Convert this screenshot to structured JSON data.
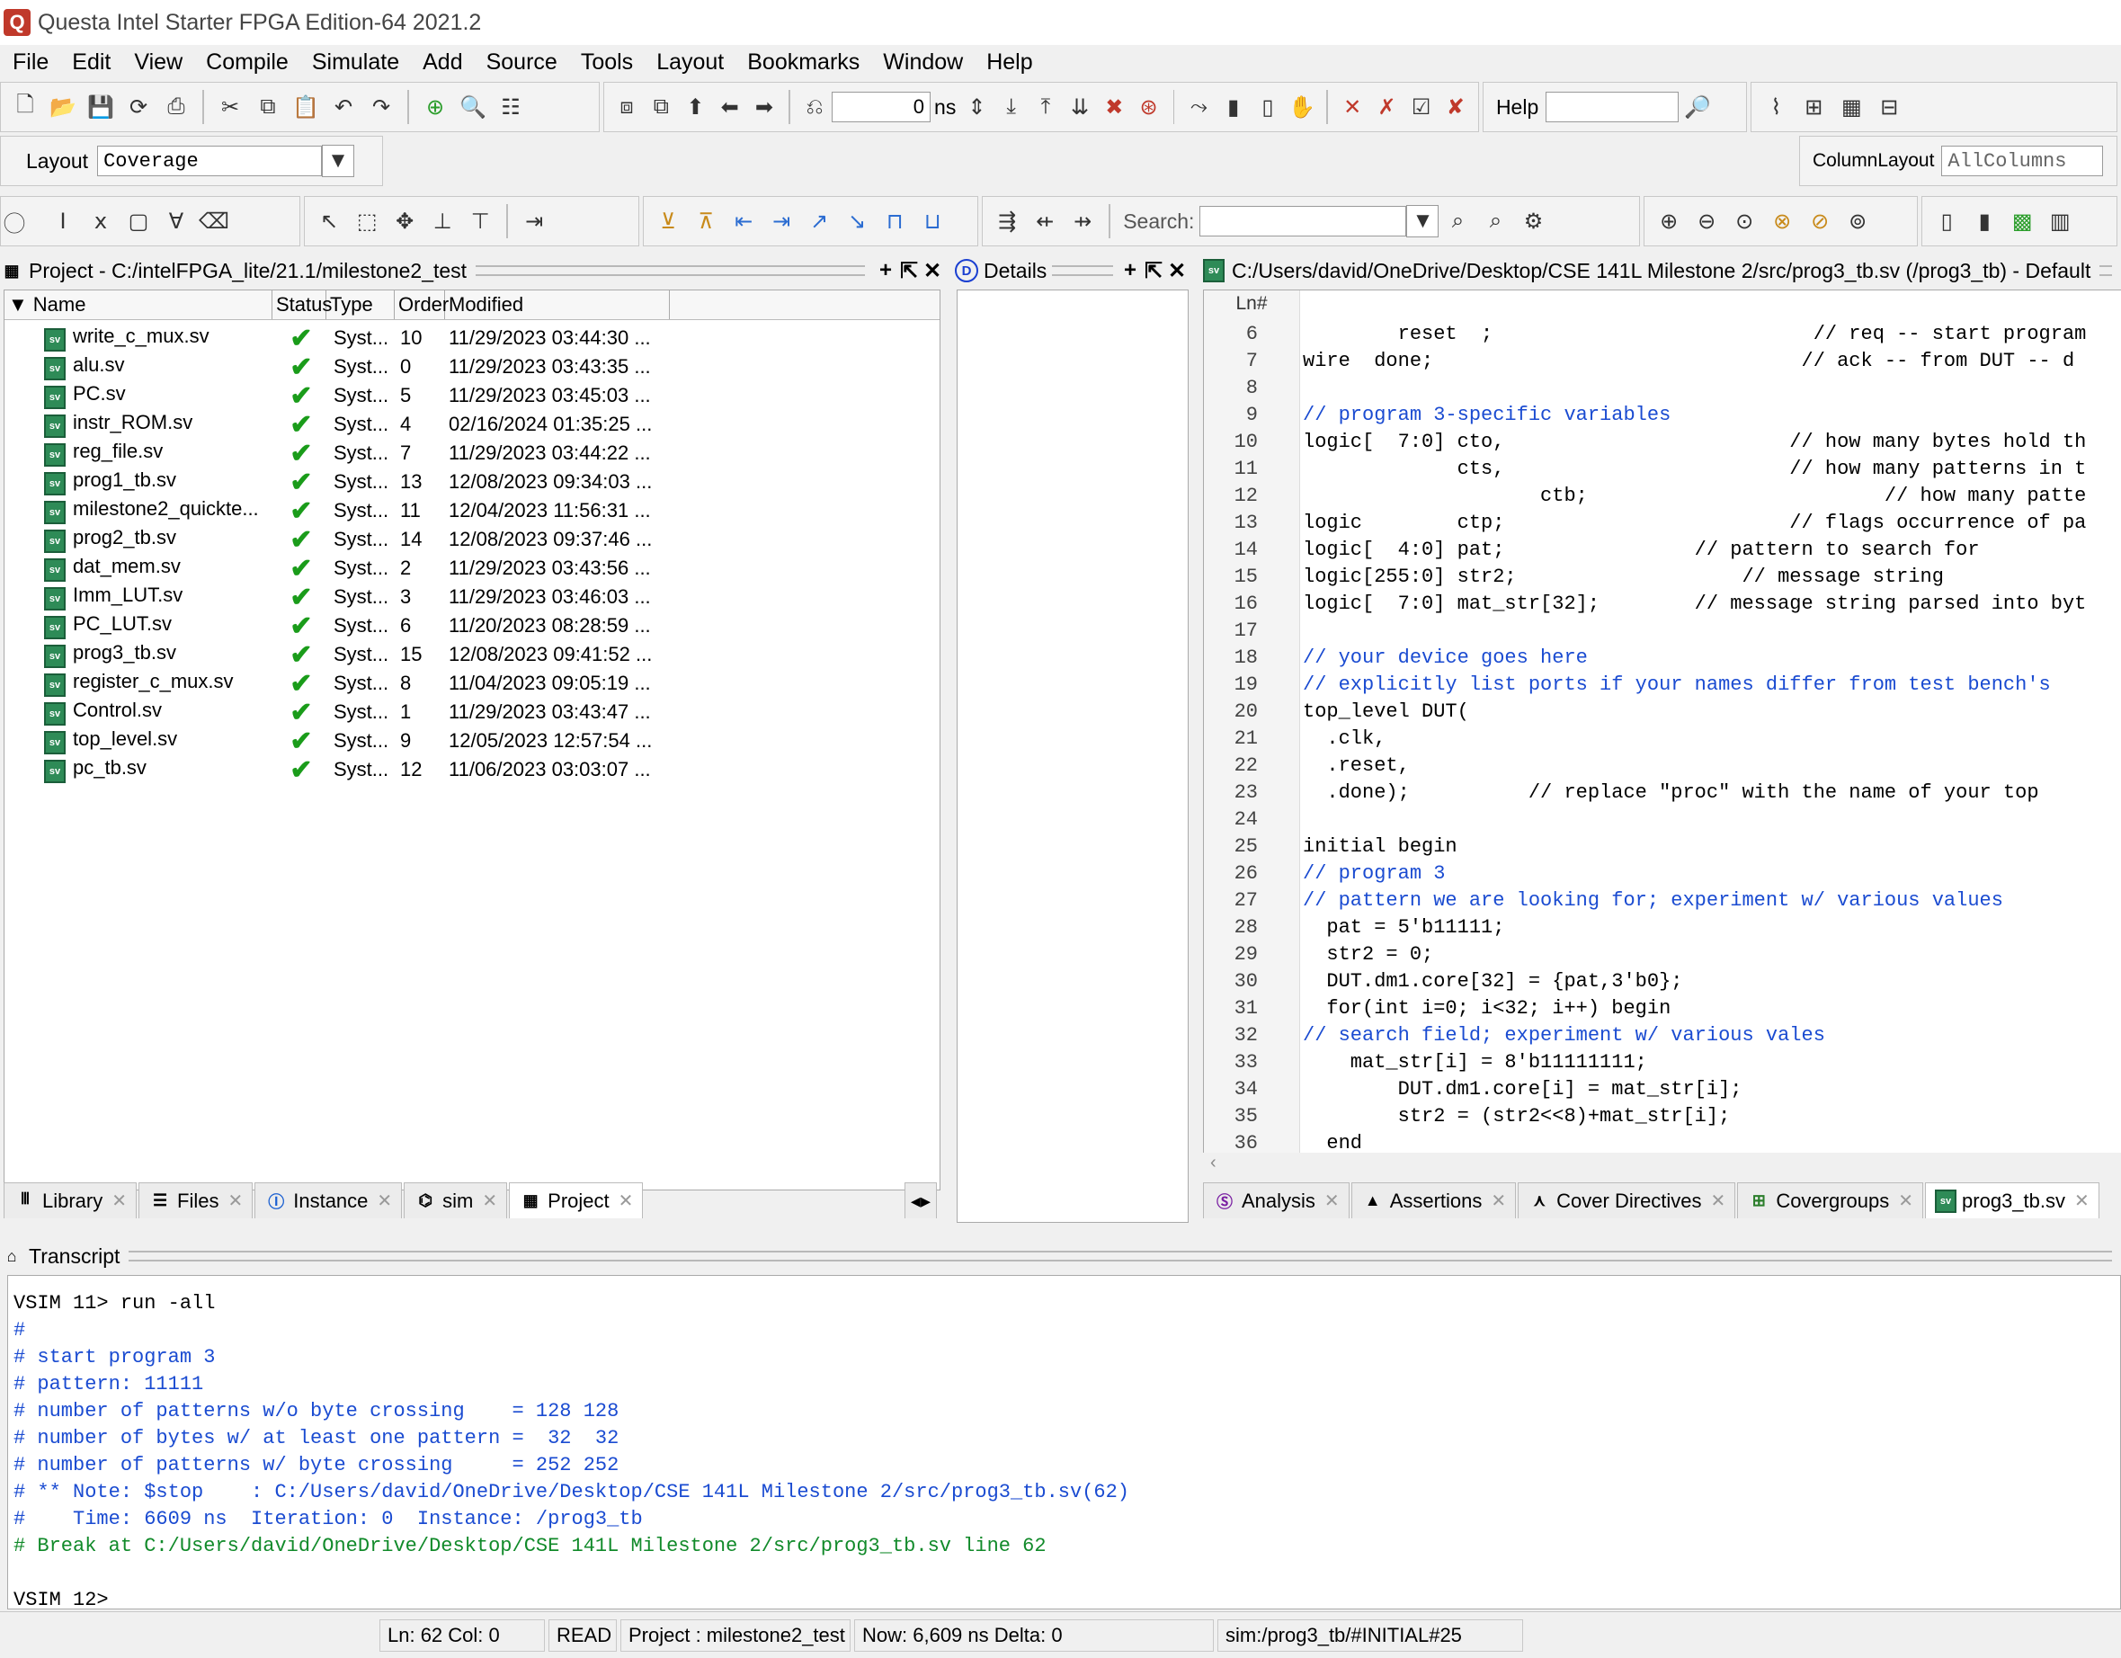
{
  "window": {
    "title": "Questa Intel Starter FPGA Edition-64 2021.2"
  },
  "menu": [
    "File",
    "Edit",
    "View",
    "Compile",
    "Simulate",
    "Add",
    "Source",
    "Tools",
    "Layout",
    "Bookmarks",
    "Window",
    "Help"
  ],
  "toolbar": {
    "time_value": "0",
    "time_unit": "ns",
    "help_label": "Help",
    "help_input": "",
    "layout_label": "Layout",
    "layout_value": "Coverage",
    "column_layout_label": "ColumnLayout",
    "column_layout_value": "AllColumns",
    "search_label": "Search:",
    "search_value": ""
  },
  "project": {
    "title": "Project - C:/intelFPGA_lite/21.1/milestone2_test",
    "columns": [
      "Name",
      "Status",
      "Type",
      "Order",
      "Modified"
    ],
    "rows": [
      {
        "name": "write_c_mux.sv",
        "type": "Syst...",
        "order": "10",
        "modified": "11/29/2023 03:44:30 ..."
      },
      {
        "name": "alu.sv",
        "type": "Syst...",
        "order": "0",
        "modified": "11/29/2023 03:43:35 ..."
      },
      {
        "name": "PC.sv",
        "type": "Syst...",
        "order": "5",
        "modified": "11/29/2023 03:45:03 ..."
      },
      {
        "name": "instr_ROM.sv",
        "type": "Syst...",
        "order": "4",
        "modified": "02/16/2024 01:35:25 ..."
      },
      {
        "name": "reg_file.sv",
        "type": "Syst...",
        "order": "7",
        "modified": "11/29/2023 03:44:22 ..."
      },
      {
        "name": "prog1_tb.sv",
        "type": "Syst...",
        "order": "13",
        "modified": "12/08/2023 09:34:03 ..."
      },
      {
        "name": "milestone2_quickte...",
        "type": "Syst...",
        "order": "11",
        "modified": "12/04/2023 11:56:31 ..."
      },
      {
        "name": "prog2_tb.sv",
        "type": "Syst...",
        "order": "14",
        "modified": "12/08/2023 09:37:46 ..."
      },
      {
        "name": "dat_mem.sv",
        "type": "Syst...",
        "order": "2",
        "modified": "11/29/2023 03:43:56 ..."
      },
      {
        "name": "Imm_LUT.sv",
        "type": "Syst...",
        "order": "3",
        "modified": "11/29/2023 03:46:03 ..."
      },
      {
        "name": "PC_LUT.sv",
        "type": "Syst...",
        "order": "6",
        "modified": "11/20/2023 08:28:59 ..."
      },
      {
        "name": "prog3_tb.sv",
        "type": "Syst...",
        "order": "15",
        "modified": "12/08/2023 09:41:52 ..."
      },
      {
        "name": "register_c_mux.sv",
        "type": "Syst...",
        "order": "8",
        "modified": "11/04/2023 09:05:19 ..."
      },
      {
        "name": "Control.sv",
        "type": "Syst...",
        "order": "1",
        "modified": "11/29/2023 03:43:47 ..."
      },
      {
        "name": "top_level.sv",
        "type": "Syst...",
        "order": "9",
        "modified": "12/05/2023 12:57:54 ..."
      },
      {
        "name": "pc_tb.sv",
        "type": "Syst...",
        "order": "12",
        "modified": "11/06/2023 03:03:07 ..."
      }
    ],
    "tabs": [
      "Library",
      "Files",
      "Instance",
      "sim",
      "Project"
    ]
  },
  "details": {
    "title": "Details"
  },
  "editor": {
    "title": "C:/Users/david/OneDrive/Desktop/CSE 141L Milestone 2/src/prog3_tb.sv (/prog3_tb) - Default",
    "ln_header": "Ln#",
    "lines": [
      {
        "n": "6",
        "text": "        reset  ;                           // req -- start program"
      },
      {
        "n": "7",
        "text": "wire  done;                               // ack -- from DUT -- d"
      },
      {
        "n": "8",
        "text": ""
      },
      {
        "n": "9",
        "text": "// program 3-specific variables"
      },
      {
        "n": "10",
        "text": "logic[  7:0] cto,                        // how many bytes hold th"
      },
      {
        "n": "11",
        "text": "             cts,                        // how many patterns in t"
      },
      {
        "n": "12",
        "text": "                    ctb;                         // how many patte"
      },
      {
        "n": "13",
        "text": "logic        ctp;                        // flags occurrence of pa"
      },
      {
        "n": "14",
        "text": "logic[  4:0] pat;                // pattern to search for"
      },
      {
        "n": "15",
        "text": "logic[255:0] str2;                   // message string"
      },
      {
        "n": "16",
        "text": "logic[  7:0] mat_str[32];        // message string parsed into byt"
      },
      {
        "n": "17",
        "text": ""
      },
      {
        "n": "18",
        "text": "// your device goes here"
      },
      {
        "n": "19",
        "text": "// explicitly list ports if your names differ from test bench's"
      },
      {
        "n": "20",
        "text": "top_level DUT("
      },
      {
        "n": "21",
        "text": "  .clk,"
      },
      {
        "n": "22",
        "text": "  .reset,"
      },
      {
        "n": "23",
        "text": "  .done);          // replace \"proc\" with the name of your top"
      },
      {
        "n": "24",
        "text": ""
      },
      {
        "n": "25",
        "text": "initial begin"
      },
      {
        "n": "26",
        "text": "// program 3"
      },
      {
        "n": "27",
        "text": "// pattern we are looking for; experiment w/ various values"
      },
      {
        "n": "28",
        "text": "  pat = 5'b11111;"
      },
      {
        "n": "29",
        "text": "  str2 = 0;"
      },
      {
        "n": "30",
        "text": "  DUT.dm1.core[32] = {pat,3'b0};"
      },
      {
        "n": "31",
        "text": "  for(int i=0; i<32; i++) begin"
      },
      {
        "n": "32",
        "text": "// search field; experiment w/ various vales"
      },
      {
        "n": "33",
        "text": "    mat_str[i] = 8'b11111111;"
      },
      {
        "n": "34",
        "text": "        DUT.dm1.core[i] = mat_str[i];"
      },
      {
        "n": "35",
        "text": "        str2 = (str2<<8)+mat_str[i];"
      },
      {
        "n": "36",
        "text": "  end"
      }
    ],
    "tabs": [
      "Analysis",
      "Assertions",
      "Cover Directives",
      "Covergroups",
      "prog3_tb.sv"
    ]
  },
  "transcript": {
    "title": "Transcript",
    "lines": [
      {
        "text": "VSIM 11> run -all",
        "color": "black"
      },
      {
        "text": "#",
        "color": "blue"
      },
      {
        "text": "# start program 3",
        "color": "blue"
      },
      {
        "text": "# pattern: 11111",
        "color": "blue"
      },
      {
        "text": "# number of patterns w/o byte crossing    = 128 128",
        "color": "blue"
      },
      {
        "text": "# number of bytes w/ at least one pattern =  32  32",
        "color": "blue"
      },
      {
        "text": "# number of patterns w/ byte crossing     = 252 252",
        "color": "blue"
      },
      {
        "text": "# ** Note: $stop    : C:/Users/david/OneDrive/Desktop/CSE 141L Milestone 2/src/prog3_tb.sv(62)",
        "color": "blue"
      },
      {
        "text": "#    Time: 6609 ns  Iteration: 0  Instance: /prog3_tb",
        "color": "blue"
      },
      {
        "text": "# Break at C:/Users/david/OneDrive/Desktop/CSE 141L Milestone 2/src/prog3_tb.sv line 62",
        "color": "green"
      },
      {
        "text": "",
        "color": "black"
      },
      {
        "text": "VSIM 12>",
        "color": "black"
      }
    ]
  },
  "status": {
    "ln_col": "Ln:  62 Col: 0",
    "mode": "READ",
    "project": "Project : milestone2_test",
    "now": "Now: 6,609 ns   Delta: 0",
    "context": "sim:/prog3_tb/#INITIAL#25"
  },
  "colors": {
    "keyword": "#a31515",
    "comment": "#1a4bd1",
    "transcript_green": "#118a2a"
  }
}
